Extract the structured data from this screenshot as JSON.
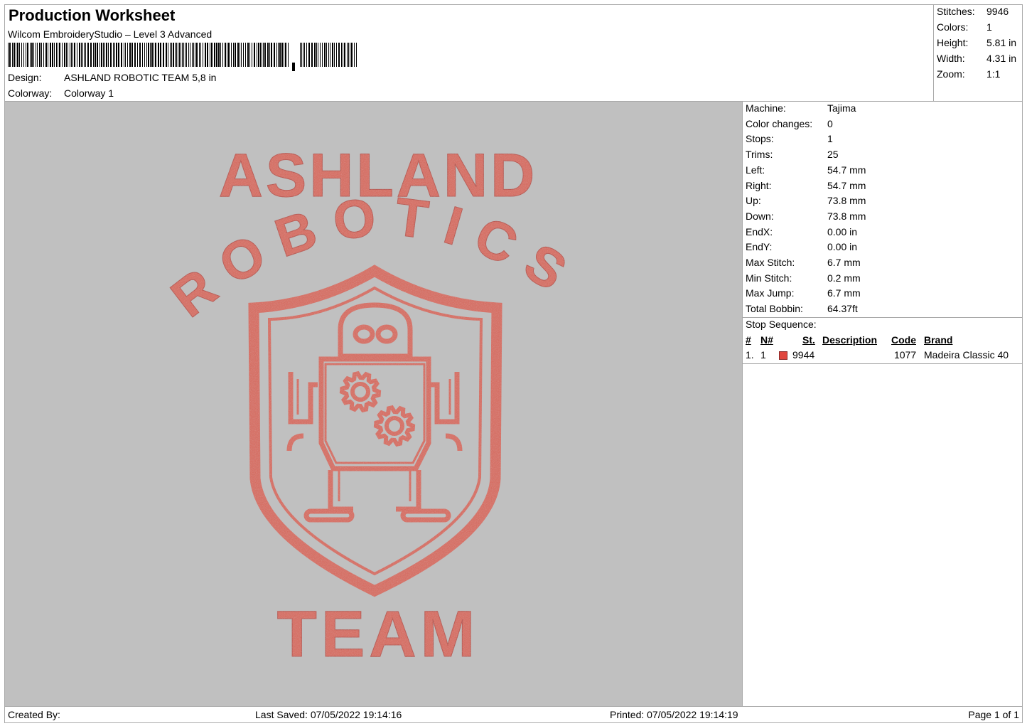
{
  "header": {
    "title": "Production Worksheet",
    "software": "Wilcom EmbroideryStudio – Level 3 Advanced",
    "design_label": "Design:",
    "design_value": "ASHLAND ROBOTIC TEAM 5,8 in",
    "colorway_label": "Colorway:",
    "colorway_value": "Colorway 1"
  },
  "summary": [
    {
      "label": "Stitches:",
      "value": "9946"
    },
    {
      "label": "Colors:",
      "value": "1"
    },
    {
      "label": "Height:",
      "value": "5.81 in"
    },
    {
      "label": "Width:",
      "value": "4.31 in"
    },
    {
      "label": "Zoom:",
      "value": "1:1"
    }
  ],
  "machine_info": [
    {
      "label": "Machine:",
      "value": "Tajima"
    },
    {
      "label": "Color changes:",
      "value": "0"
    },
    {
      "label": "Stops:",
      "value": "1"
    },
    {
      "label": "Trims:",
      "value": "25"
    },
    {
      "label": "Left:",
      "value": "54.7 mm"
    },
    {
      "label": "Right:",
      "value": "54.7 mm"
    },
    {
      "label": "Up:",
      "value": "73.8 mm"
    },
    {
      "label": "Down:",
      "value": "73.8 mm"
    },
    {
      "label": "EndX:",
      "value": "0.00 in"
    },
    {
      "label": "EndY:",
      "value": "0.00 in"
    },
    {
      "label": "Max Stitch:",
      "value": "6.7 mm"
    },
    {
      "label": "Min Stitch:",
      "value": "0.2 mm"
    },
    {
      "label": "Max Jump:",
      "value": "6.7 mm"
    },
    {
      "label": "Total Bobbin:",
      "value": "64.37ft"
    }
  ],
  "stop_sequence": {
    "label": "Stop Sequence:",
    "headers": {
      "num": "#",
      "needle": "N#",
      "stitches": "St.",
      "description": "Description",
      "code": "Code",
      "brand": "Brand"
    },
    "rows": [
      {
        "num": "1.",
        "needle": "1",
        "color": "#e0463e",
        "stitches": "9944",
        "description": "",
        "code": "1077",
        "brand": "Madeira Classic 40"
      }
    ]
  },
  "design": {
    "thread_color": "#d9675a",
    "thread_dark": "#b94a3f",
    "background": "#c0c0c0",
    "text_top": "ASHLAND",
    "text_arc": "ROBOTICS",
    "text_bottom": "TEAM"
  },
  "footer": {
    "created_by": "Created By:",
    "last_saved": "Last Saved: 07/05/2022 19:14:16",
    "printed": "Printed: 07/05/2022 19:14:19",
    "page": "Page 1 of 1"
  }
}
